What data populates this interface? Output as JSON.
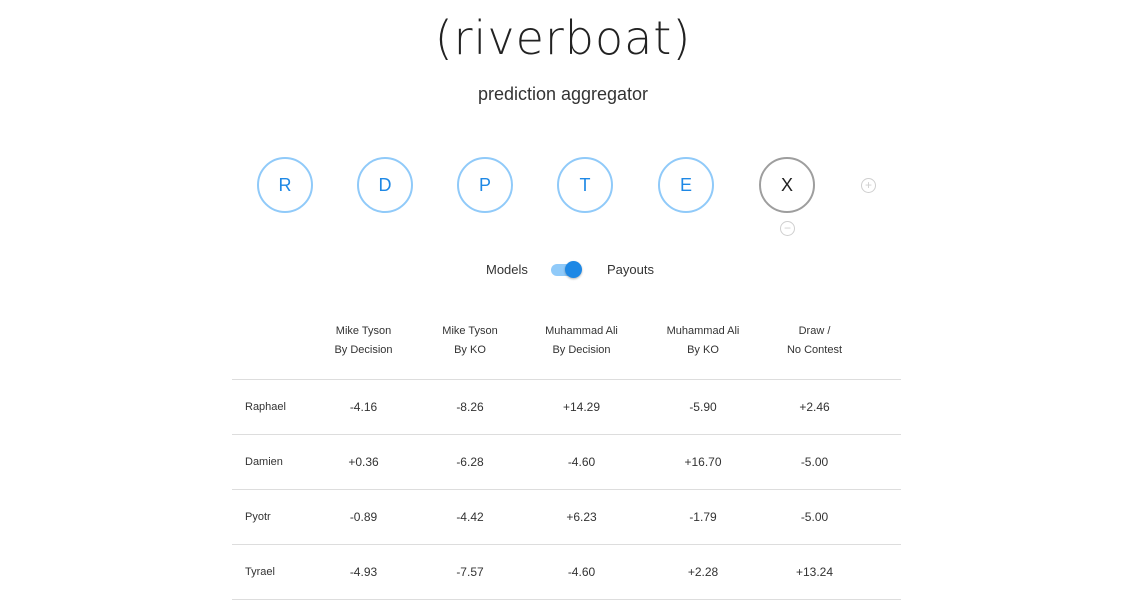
{
  "app": {
    "title": "(riverboat)",
    "subtitle": "prediction aggregator"
  },
  "models": [
    {
      "letter": "R",
      "active": true
    },
    {
      "letter": "D",
      "active": true
    },
    {
      "letter": "P",
      "active": true
    },
    {
      "letter": "T",
      "active": true
    },
    {
      "letter": "E",
      "active": true
    },
    {
      "letter": "X",
      "active": false
    }
  ],
  "controls": {
    "add_icon": "plus-circle-icon",
    "remove_icon": "minus-circle-icon",
    "add_glyph": "+",
    "remove_glyph": "−"
  },
  "toggle": {
    "left_label": "Models",
    "right_label": "Payouts",
    "state": "Payouts"
  },
  "table": {
    "columns": [
      {
        "line1": "Mike Tyson",
        "line2": "By Decision"
      },
      {
        "line1": "Mike Tyson",
        "line2": "By KO"
      },
      {
        "line1": "Muhammad Ali",
        "line2": "By Decision"
      },
      {
        "line1": "Muhammad Ali",
        "line2": "By KO"
      },
      {
        "line1": "Draw /",
        "line2": "No Contest"
      }
    ],
    "rows": [
      {
        "name": "Raphael",
        "values": [
          "-4.16",
          "-8.26",
          "+14.29",
          "-5.90",
          "+2.46"
        ]
      },
      {
        "name": "Damien",
        "values": [
          "+0.36",
          "-6.28",
          "-4.60",
          "+16.70",
          "-5.00"
        ]
      },
      {
        "name": "Pyotr",
        "values": [
          "-0.89",
          "-4.42",
          "+6.23",
          "-1.79",
          "-5.00"
        ]
      },
      {
        "name": "Tyrael",
        "values": [
          "-4.93",
          "-7.57",
          "-4.60",
          "+2.28",
          "+13.24"
        ]
      }
    ]
  },
  "colors": {
    "accent": "#1e88e5",
    "accent_light": "#90caf9",
    "negative": "#e91e63",
    "positive": "#333333"
  }
}
